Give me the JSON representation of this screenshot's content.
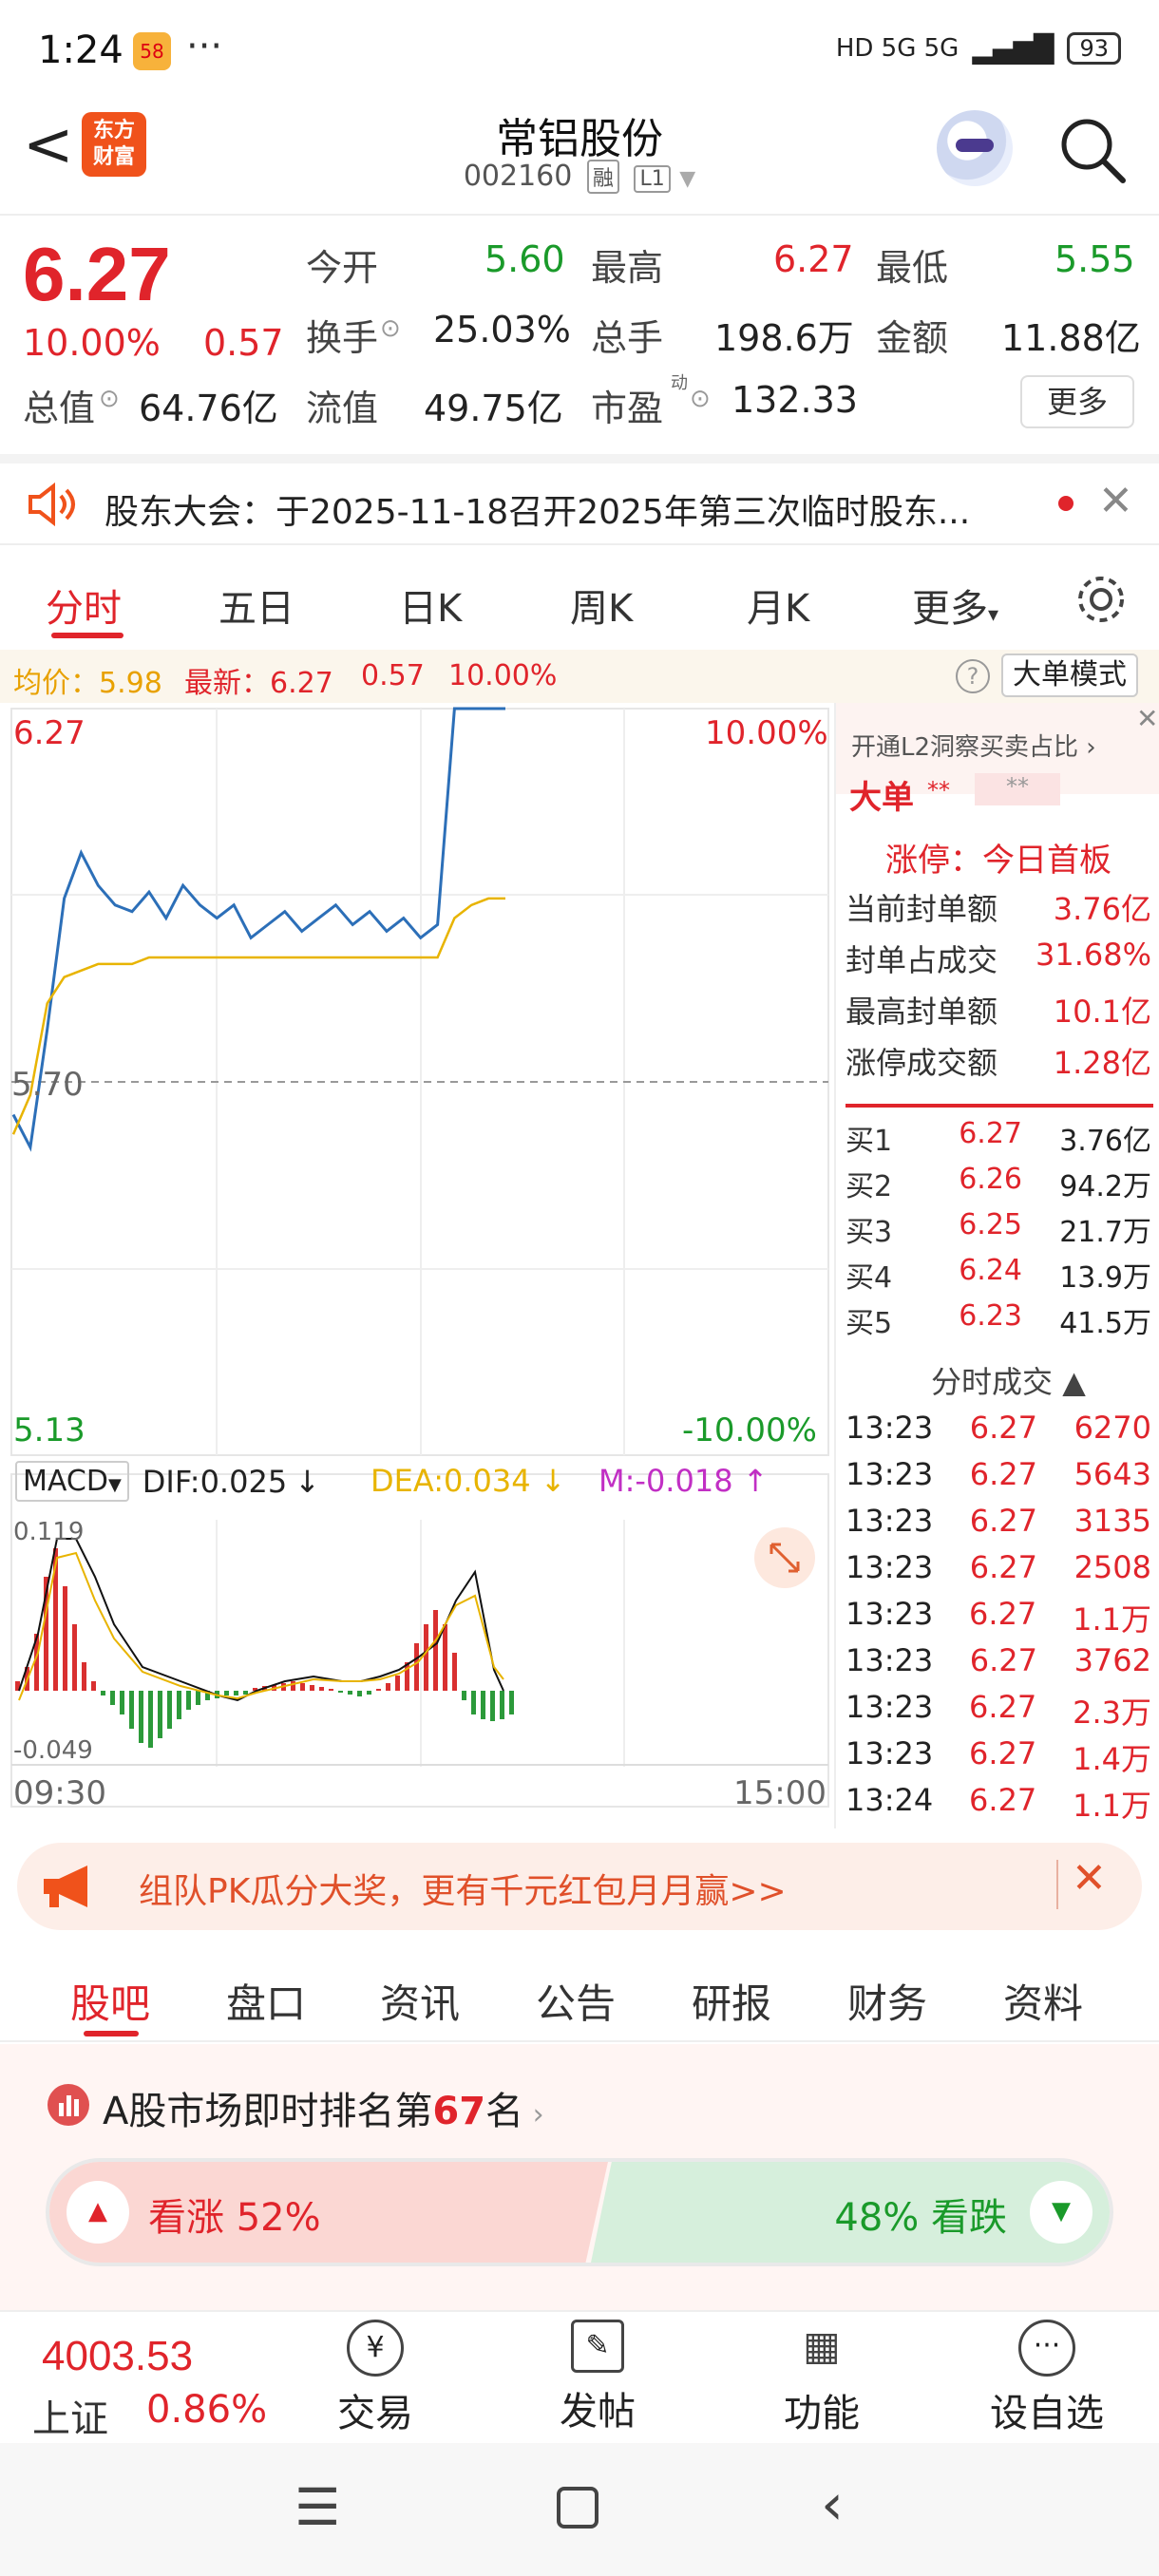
{
  "status": {
    "time": "1:24",
    "app_badge": "58",
    "more": "···",
    "network": "HD 5G 5G",
    "battery": "93"
  },
  "header": {
    "back": "<",
    "logo_line1": "东方",
    "logo_line2": "财富",
    "stock_name": "常铝股份",
    "stock_code": "002160",
    "tag1": "融",
    "tag2": "L1"
  },
  "quote": {
    "price": "6.27",
    "pct": "10.00%",
    "change": "0.57",
    "open_label": "今开",
    "open": "5.60",
    "high_label": "最高",
    "high": "6.27",
    "low_label": "最低",
    "low": "5.55",
    "turnover_label": "换手",
    "turnover": "25.03%",
    "volume_label": "总手",
    "volume": "198.6万",
    "amount_label": "金额",
    "amount": "11.88亿",
    "mcap_label": "总值",
    "mcap": "64.76亿",
    "float_label": "流值",
    "float": "49.75亿",
    "pe_label": "市盈",
    "pe_sup": "动",
    "pe": "132.33",
    "more": "更多"
  },
  "notice": {
    "text": "股东大会：于2025-11-18召开2025年第三次临时股东..."
  },
  "chart_tabs": [
    "分时",
    "五日",
    "日K",
    "周K",
    "月K",
    "更多"
  ],
  "infoline": {
    "avg_label": "均价：5.98",
    "last_label": "最新：6.27",
    "chg": "0.57",
    "pct": "10.00%",
    "mode_btn": "大单模式"
  },
  "chart_labels": {
    "top_price": "6.27",
    "top_pct": "10.00%",
    "mid_price": "5.70",
    "bottom_price": "5.13",
    "bottom_pct": "-10.00%",
    "t_start": "09:30",
    "t_end": "15:00"
  },
  "macd": {
    "select": "MACD",
    "dif": "DIF:0.025",
    "dea": "DEA:0.034",
    "m": "M:-0.018",
    "top": "0.119",
    "bottom": "-0.049"
  },
  "chart_data": {
    "type": "line",
    "series": [
      {
        "values": [
          5.65,
          5.6,
          5.78,
          5.98,
          6.05,
          6.0,
          5.97,
          5.96,
          5.99,
          5.95,
          6.0,
          5.97,
          5.95,
          5.97,
          5.92,
          5.94,
          5.96,
          5.93,
          5.95,
          5.97,
          5.94,
          5.96,
          5.93,
          5.95,
          5.92,
          5.94,
          6.27,
          6.27,
          6.27,
          6.27
        ]
      },
      {
        "values": [
          5.62,
          5.68,
          5.82,
          5.86,
          5.87,
          5.88,
          5.88,
          5.88,
          5.89,
          5.89,
          5.89,
          5.89,
          5.89,
          5.89,
          5.89,
          5.89,
          5.89,
          5.89,
          5.89,
          5.89,
          5.89,
          5.89,
          5.89,
          5.89,
          5.89,
          5.89,
          5.95,
          5.97,
          5.98,
          5.98
        ]
      }
    ],
    "ylim": [
      5.13,
      6.27
    ]
  },
  "sidepanel": {
    "l2_link": "开通L2洞察买卖占比",
    "big_order": "大单",
    "stars1": "**",
    "stars2": "**",
    "limit_title": "涨停：今日首板",
    "stats": [
      {
        "label": "当前封单额",
        "value": "3.76亿"
      },
      {
        "label": "封单占成交",
        "value": "31.68%"
      },
      {
        "label": "最高封单额",
        "value": "10.1亿"
      },
      {
        "label": "涨停成交额",
        "value": "1.28亿"
      }
    ],
    "bids": [
      {
        "label": "买1",
        "price": "6.27",
        "vol": "3.76亿"
      },
      {
        "label": "买2",
        "price": "6.26",
        "vol": "94.2万"
      },
      {
        "label": "买3",
        "price": "6.25",
        "vol": "21.7万"
      },
      {
        "label": "买4",
        "price": "6.24",
        "vol": "13.9万"
      },
      {
        "label": "买5",
        "price": "6.23",
        "vol": "41.5万"
      }
    ],
    "trades_title": "分时成交",
    "trades": [
      {
        "t": "13:23",
        "p": "6.27",
        "v": "6270"
      },
      {
        "t": "13:23",
        "p": "6.27",
        "v": "5643"
      },
      {
        "t": "13:23",
        "p": "6.27",
        "v": "3135"
      },
      {
        "t": "13:23",
        "p": "6.27",
        "v": "2508"
      },
      {
        "t": "13:23",
        "p": "6.27",
        "v": "1.1万"
      },
      {
        "t": "13:23",
        "p": "6.27",
        "v": "3762"
      },
      {
        "t": "13:23",
        "p": "6.27",
        "v": "2.3万"
      },
      {
        "t": "13:23",
        "p": "6.27",
        "v": "1.4万"
      },
      {
        "t": "13:24",
        "p": "6.27",
        "v": "1.1万"
      }
    ]
  },
  "ad": {
    "text": "组队PK瓜分大奖，更有千元红包月月赢>>"
  },
  "bottom_tabs": [
    "股吧",
    "盘口",
    "资讯",
    "公告",
    "研报",
    "财务",
    "资料"
  ],
  "ranking": {
    "pre": "A股市场即时排名第",
    "rank": "67",
    "post": "名",
    "up_label": "看涨 52%",
    "down_label": "48% 看跌"
  },
  "footer": {
    "index_value": "4003.53",
    "index_name": "上证",
    "index_pct": "0.86%",
    "trade": "交易",
    "post": "发帖",
    "func": "功能",
    "watch": "设自选"
  }
}
